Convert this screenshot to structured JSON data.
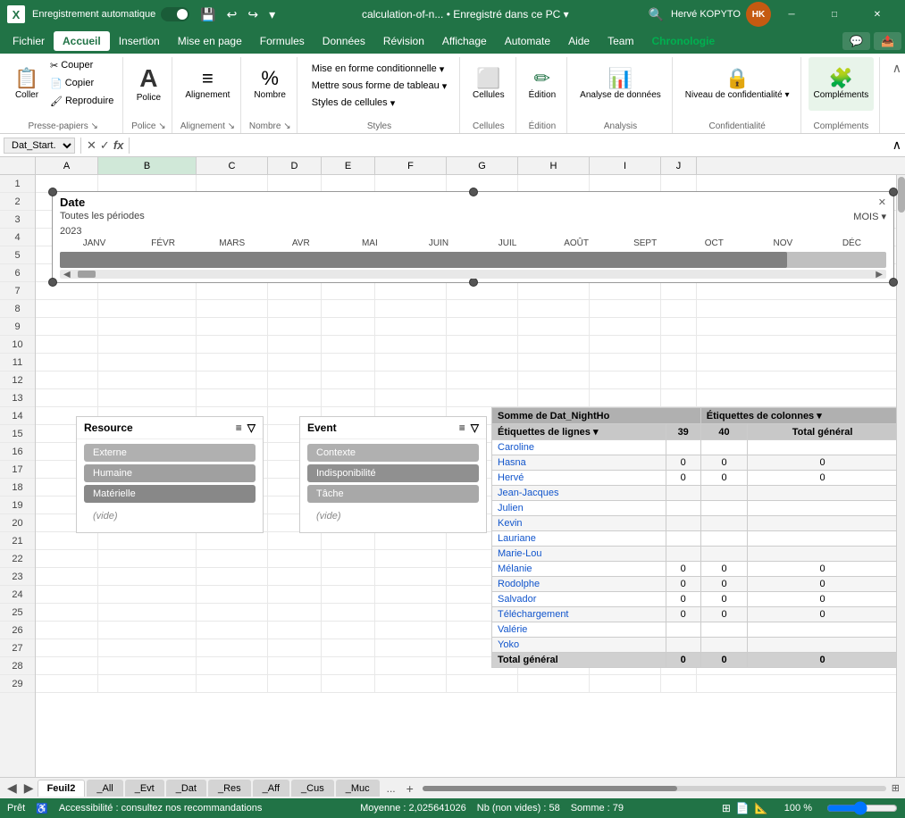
{
  "titleBar": {
    "appIcon": "X",
    "autoSave": "Enregistrement automatique",
    "fileName": "calculation-of-n...",
    "savedStatus": "Enregistré dans ce PC",
    "userName": "Hervé KOPYTO",
    "userInitials": "HK",
    "searchIcon": "🔍",
    "undoIcon": "↩",
    "redoIcon": "↪",
    "dropdownIcon": "▾"
  },
  "menuBar": {
    "items": [
      "Fichier",
      "Accueil",
      "Insertion",
      "Mise en page",
      "Formules",
      "Données",
      "Révision",
      "Affichage",
      "Automate",
      "Aide",
      "Team",
      "Chronologie"
    ],
    "activeItem": "Accueil",
    "chronologieItem": "Chronologie",
    "rightIcons": [
      "💬",
      "📤"
    ]
  },
  "ribbon": {
    "groups": [
      {
        "label": "Presse-papiers",
        "buttons": [
          {
            "label": "Coller",
            "icon": "📋",
            "type": "large"
          },
          {
            "label": "Couper",
            "icon": "✂"
          },
          {
            "label": "Copier",
            "icon": "📄"
          },
          {
            "label": "Reproduire",
            "icon": "🖌"
          }
        ]
      },
      {
        "label": "Police",
        "buttons": [
          {
            "label": "Police",
            "icon": "A",
            "type": "large"
          }
        ]
      },
      {
        "label": "Alignement",
        "buttons": [
          {
            "label": "Alignement",
            "icon": "≡",
            "type": "large"
          }
        ]
      },
      {
        "label": "Nombre",
        "buttons": [
          {
            "label": "Nombre",
            "icon": "%",
            "type": "large"
          }
        ]
      },
      {
        "label": "Styles",
        "buttons": [
          {
            "label": "Mise en forme conditionnelle ▾",
            "icon": ""
          },
          {
            "label": "Mettre sous forme de tableau ▾",
            "icon": ""
          },
          {
            "label": "Styles de cellules ▾",
            "icon": ""
          }
        ]
      },
      {
        "label": "Cellules",
        "buttons": [
          {
            "label": "Cellules",
            "icon": "⬜",
            "type": "large"
          }
        ]
      },
      {
        "label": "Édition",
        "buttons": [
          {
            "label": "Édition",
            "icon": "✏",
            "type": "large"
          }
        ]
      },
      {
        "label": "Analysis",
        "buttons": [
          {
            "label": "Analyse de données",
            "icon": "📊",
            "type": "large"
          }
        ]
      },
      {
        "label": "Confidentialité",
        "buttons": [
          {
            "label": "Niveau de confidentialité ▾",
            "icon": "🔒",
            "type": "large"
          }
        ]
      },
      {
        "label": "Compléments",
        "buttons": [
          {
            "label": "Compléments",
            "icon": "🧩",
            "type": "large"
          }
        ]
      }
    ]
  },
  "formulaBar": {
    "nameBox": "Dat_Start...",
    "functionIcon": "f",
    "cancelIcon": "✕",
    "confirmIcon": "✓",
    "value": ""
  },
  "columns": {
    "widths": [
      40,
      70,
      90,
      70,
      70,
      50,
      90,
      90,
      70,
      90,
      30
    ],
    "labels": [
      "",
      "A",
      "B",
      "C",
      "D",
      "E",
      "F",
      "G",
      "H",
      "I",
      "J"
    ]
  },
  "timeline": {
    "title": "Date",
    "subtitle": "Toutes les périodes",
    "moisLabel": "MOIS",
    "year": "2023",
    "months": [
      "JANV",
      "FÉVR",
      "MARS",
      "AVR",
      "MAI",
      "JUIN",
      "JUIL",
      "AOÛT",
      "SEPT",
      "OCT",
      "NOV",
      "DÉC"
    ]
  },
  "resourceFilter": {
    "title": "Resource",
    "items": [
      "Externe",
      "Humaine",
      "Matérielle",
      "(vide)"
    ]
  },
  "eventFilter": {
    "title": "Event",
    "items": [
      "Contexte",
      "Indisponibilité",
      "Tâche",
      "(vide)"
    ]
  },
  "pivotTable": {
    "headerCol1": "Somme de Dat_NightHo",
    "headerCol2": "Étiquettes de colonnes",
    "filterIcon": "▾",
    "subheader": {
      "rowLabel": "Étiquettes de lignes",
      "rowFilterIcon": "▾",
      "col1": "39",
      "col2": "40",
      "col3": "Total général"
    },
    "rows": [
      {
        "label": "Caroline",
        "col1": "",
        "col2": "",
        "col3": ""
      },
      {
        "label": "Hasna",
        "col1": "0",
        "col2": "0",
        "col3": "0"
      },
      {
        "label": "Hervé",
        "col1": "0",
        "col2": "0",
        "col3": "0"
      },
      {
        "label": "Jean-Jacques",
        "col1": "",
        "col2": "",
        "col3": ""
      },
      {
        "label": "Julien",
        "col1": "",
        "col2": "",
        "col3": ""
      },
      {
        "label": "Kevin",
        "col1": "",
        "col2": "",
        "col3": ""
      },
      {
        "label": "Lauriane",
        "col1": "",
        "col2": "",
        "col3": ""
      },
      {
        "label": "Marie-Lou",
        "col1": "",
        "col2": "",
        "col3": ""
      },
      {
        "label": "Mélanie",
        "col1": "0",
        "col2": "0",
        "col3": "0"
      },
      {
        "label": "Rodolphe",
        "col1": "0",
        "col2": "0",
        "col3": "0"
      },
      {
        "label": "Salvador",
        "col1": "0",
        "col2": "0",
        "col3": "0"
      },
      {
        "label": "Téléchargement",
        "col1": "0",
        "col2": "0",
        "col3": "0"
      },
      {
        "label": "Valérie",
        "col1": "",
        "col2": "",
        "col3": ""
      },
      {
        "label": "Yoko",
        "col1": "",
        "col2": "",
        "col3": ""
      },
      {
        "label": "Total général",
        "col1": "0",
        "col2": "0",
        "col3": "0",
        "bold": true
      }
    ]
  },
  "sheetTabs": {
    "tabs": [
      "Feuil2",
      "_All",
      "_Evt",
      "_Dat",
      "_Res",
      "_Aff",
      "_Cus",
      "_Muc"
    ],
    "activeTab": "Feuil2",
    "moreIcon": "..."
  },
  "statusBar": {
    "ready": "Prêt",
    "accessibilityIcon": "♿",
    "accessibilityText": "Accessibilité : consultez nos recommandations",
    "average": "Moyenne : 2,025641026",
    "count": "Nb (non vides) : 58",
    "sum": "Somme : 79",
    "viewIcons": [
      "⊞",
      "📄",
      "📐"
    ],
    "zoom": "100 %"
  },
  "rowNumbers": [
    1,
    2,
    3,
    4,
    5,
    6,
    7,
    8,
    9,
    10,
    11,
    12,
    13,
    14,
    15,
    16,
    17,
    18,
    19,
    20,
    21,
    22,
    23,
    24,
    25,
    26,
    27,
    28,
    29
  ]
}
